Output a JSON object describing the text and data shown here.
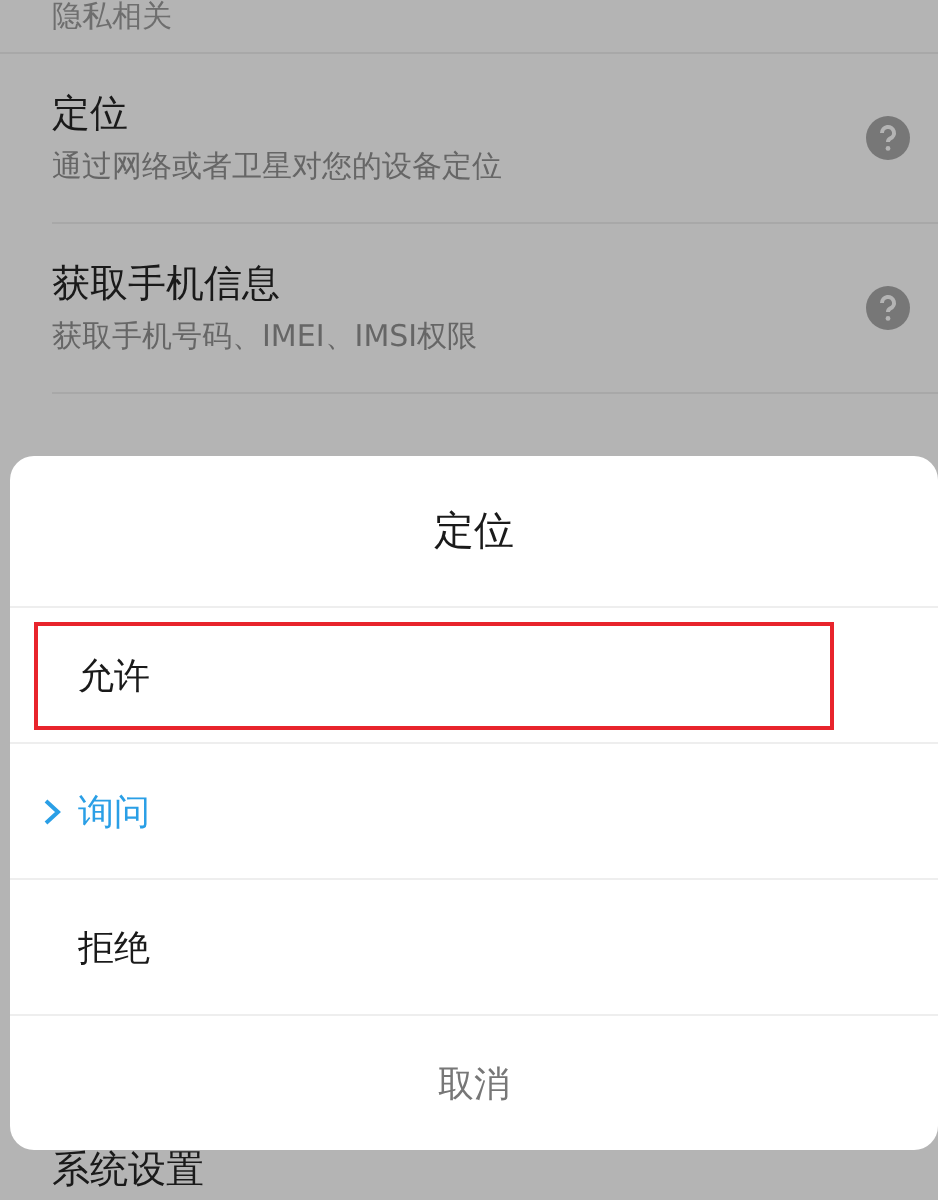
{
  "section_header": "隐私相关",
  "settings": [
    {
      "kind": "info",
      "title": "定位",
      "subtitle": "通过网络或者卫星对您的设备定位"
    },
    {
      "kind": "info",
      "title": "获取手机信息",
      "subtitle": "获取手机号码、IMEI、IMSI权限"
    }
  ],
  "footer_item": "系统设置",
  "dialog": {
    "title": "定位",
    "options": [
      {
        "label": "允许",
        "selected": false,
        "highlighted": true
      },
      {
        "label": "询问",
        "selected": true,
        "highlighted": false
      },
      {
        "label": "拒绝",
        "selected": false,
        "highlighted": false
      }
    ],
    "cancel": "取消"
  }
}
